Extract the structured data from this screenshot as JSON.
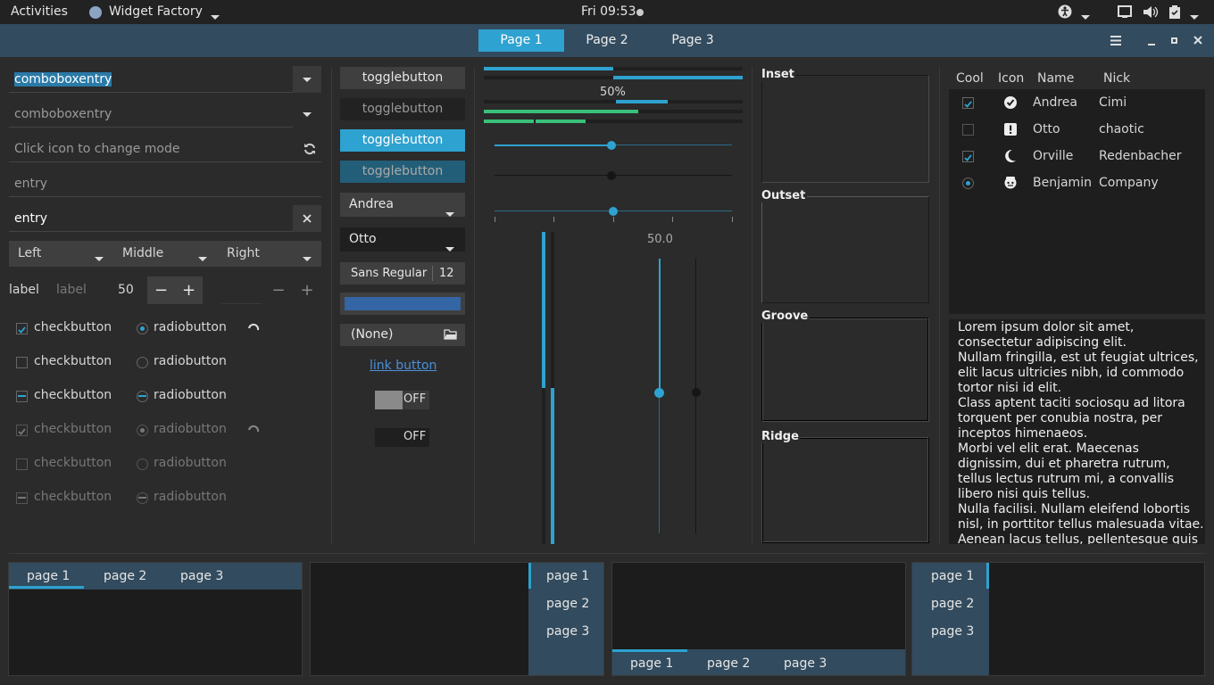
{
  "topbar": {
    "activities": "Activities",
    "app": "Widget Factory",
    "clock": "Fri 09:53"
  },
  "header": {
    "tabs": [
      "Page 1",
      "Page 2",
      "Page 3"
    ]
  },
  "entries": {
    "combo1": "comboboxentry",
    "combo2": "comboboxentry",
    "mode_placeholder": "Click icon to change mode",
    "entry1": "entry",
    "entry2": "entry"
  },
  "seg": [
    "Left",
    "Middle",
    "Right"
  ],
  "spin": {
    "label1": "label",
    "label2": "label",
    "value": "50"
  },
  "checks": [
    "checkbutton",
    "checkbutton",
    "checkbutton",
    "checkbutton",
    "checkbutton",
    "checkbutton"
  ],
  "radios": [
    "radiobutton",
    "radiobutton",
    "radiobutton",
    "radiobutton",
    "radiobutton",
    "radiobutton"
  ],
  "col2": {
    "toggles": [
      "togglebutton",
      "togglebutton",
      "togglebutton",
      "togglebutton"
    ],
    "combo_andrea": "Andrea",
    "combo_otto": "Otto",
    "font": "Sans Regular",
    "font_size": "12",
    "file": "(None)",
    "link": "link button",
    "switch1": "OFF",
    "switch2": "OFF"
  },
  "col3": {
    "progress_label": "50%",
    "scale_value": "50.0",
    "progress": 0.5
  },
  "frames": [
    "Inset",
    "Outset",
    "Groove",
    "Ridge"
  ],
  "tree": {
    "headers": [
      "Cool",
      "Icon",
      "Name",
      "Nick"
    ],
    "rows": [
      {
        "name": "Andrea",
        "nick": "Cimi"
      },
      {
        "name": "Otto",
        "nick": "chaotic"
      },
      {
        "name": "Orville",
        "nick": "Redenbacher"
      },
      {
        "name": "Benjamin",
        "nick": "Company"
      }
    ]
  },
  "text": [
    "Lorem ipsum dolor sit amet,",
    "consectetur adipiscing elit.",
    "Nullam fringilla, est ut feugiat ultrices,",
    "elit lacus ultricies nibh, id commodo",
    "tortor nisi id elit.",
    "Class aptent taciti sociosqu ad litora",
    "torquent per conubia nostra, per",
    "inceptos himenaeos.",
    "Morbi vel elit erat. Maecenas",
    "dignissim, dui et pharetra rutrum,",
    "tellus lectus rutrum mi, a convallis",
    "libero nisi quis tellus.",
    "Nulla facilisi. Nullam eleifend lobortis",
    "nisl, in porttitor tellus malesuada vitae.",
    "Aenean lacus tellus, pellentesque quis"
  ],
  "notebooks": {
    "n1": [
      "page 1",
      "page 2",
      "page 3"
    ],
    "n2": [
      "page 1",
      "page 2",
      "page 3"
    ],
    "n3": [
      "page 1",
      "page 2",
      "page 3"
    ],
    "n4": [
      "page 1",
      "page 2",
      "page 3"
    ]
  },
  "colors": {
    "accent": "#2ea2d0",
    "green": "#3ac07b",
    "header": "#324b5e"
  }
}
